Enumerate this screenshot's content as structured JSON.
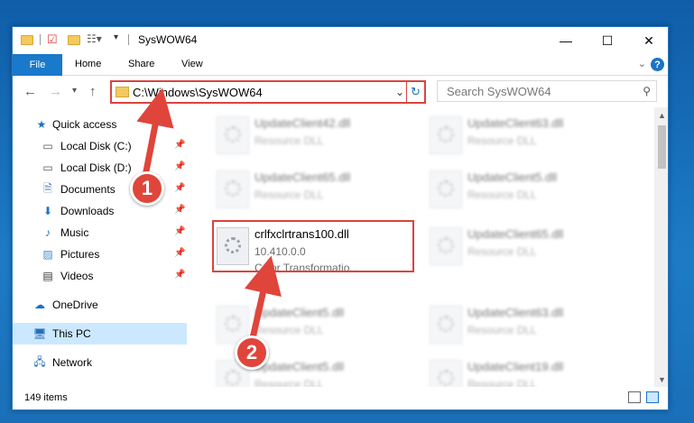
{
  "window": {
    "title": "SysWOW64"
  },
  "ribbon": {
    "file": "File",
    "tabs": [
      "Home",
      "Share",
      "View"
    ],
    "help": "?"
  },
  "nav": {
    "address": "C:\\Windows\\SysWOW64",
    "search_placeholder": "Search SysWOW64"
  },
  "sidebar": {
    "items": [
      {
        "label": "Quick access",
        "icon": "star-icon"
      },
      {
        "label": "Local Disk (C:)",
        "icon": "drive-icon",
        "pinned": true
      },
      {
        "label": "Local Disk (D:)",
        "icon": "drive-icon",
        "pinned": true
      },
      {
        "label": "Documents",
        "icon": "documents-icon",
        "pinned": true
      },
      {
        "label": "Downloads",
        "icon": "downloads-icon",
        "pinned": true
      },
      {
        "label": "Music",
        "icon": "music-icon",
        "pinned": true
      },
      {
        "label": "Pictures",
        "icon": "pictures-icon",
        "pinned": true
      },
      {
        "label": "Videos",
        "icon": "videos-icon",
        "pinned": true
      },
      {
        "label": "OneDrive",
        "icon": "cloud-icon"
      },
      {
        "label": "This PC",
        "icon": "computer-icon",
        "selected": true
      },
      {
        "label": "Network",
        "icon": "network-icon"
      }
    ]
  },
  "files": {
    "col1": [
      {
        "name": "UpdateClient42.dll",
        "sub": "Resource DLL"
      },
      {
        "name": "UpdateClient65.dll",
        "sub": "Resource DLL"
      },
      {
        "name": "crlfxclrtrans100.dll",
        "sub": "10.410.0.0",
        "sub2": "Color Transformatio..."
      },
      {
        "name": "UpdateClient5.dll",
        "sub": "Resource DLL"
      },
      {
        "name": "UpdateClient5.dll",
        "sub": "Resource DLL"
      }
    ],
    "col2": [
      {
        "name": "UpdateClient63.dll",
        "sub": "Resource DLL"
      },
      {
        "name": "UpdateClient5.dll",
        "sub": "Resource DLL"
      },
      {
        "name": "UpdateClient65.dll",
        "sub": "Resource DLL"
      },
      {
        "name": "UpdateClient63.dll",
        "sub": "Resource DLL"
      },
      {
        "name": "UpdateClient19.dll",
        "sub": "Resource DLL"
      }
    ]
  },
  "status": {
    "count": "149 items"
  },
  "annotations": {
    "step1": "1",
    "step2": "2",
    "color": "#e0453b"
  }
}
